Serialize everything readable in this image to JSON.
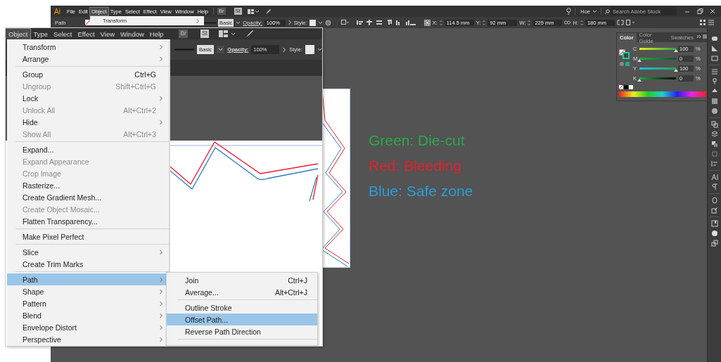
{
  "app": {
    "logo": "Ai",
    "menu": [
      {
        "label": "File",
        "selected": false
      },
      {
        "label": "Edit",
        "selected": false
      },
      {
        "label": "Object",
        "selected": true
      },
      {
        "label": "Type",
        "selected": false
      },
      {
        "label": "Select",
        "selected": false
      },
      {
        "label": "Effect",
        "selected": false
      },
      {
        "label": "View",
        "selected": false
      },
      {
        "label": "Window",
        "selected": false
      },
      {
        "label": "Help",
        "selected": false
      }
    ],
    "bridge_badge": "Br",
    "stock_badge": "St",
    "workspace": "Hoe",
    "search": {
      "placeholder": "Search Adobe Stock"
    },
    "open_menu_items": [
      "Transform"
    ]
  },
  "control_bar": {
    "selection": "Path",
    "stroke_profile": "Basic",
    "opacity_label": "Opacity:",
    "opacity": "100%",
    "style_label": "Style:",
    "x_label": "X:",
    "x": "114.5 mm",
    "y_label": "Y:",
    "y": "92 mm",
    "w_label": "W:",
    "w": "225 mm",
    "h_label": "H:",
    "h": "180 mm"
  },
  "annotations": [
    {
      "text": "Green: Die-cut",
      "color": "#2ea84a"
    },
    {
      "text": "Red: Bleeding",
      "color": "#e5202b"
    },
    {
      "text": "Blue: Safe zone",
      "color": "#2a9fd8"
    }
  ],
  "color_panel": {
    "tabs": [
      {
        "label": "Color",
        "selected": true
      },
      {
        "label": "Color Guide",
        "selected": false
      },
      {
        "label": "Swatches",
        "selected": false
      }
    ],
    "sliders": [
      {
        "channel": "C",
        "level": 1,
        "value": "100",
        "unit": "%"
      },
      {
        "channel": "M",
        "level": 0,
        "value": "0",
        "unit": "%"
      },
      {
        "channel": "Y",
        "level": 1,
        "value": "100",
        "unit": "%"
      },
      {
        "channel": "K",
        "level": 0,
        "value": "0",
        "unit": "%"
      }
    ]
  },
  "zoomed_view": {
    "menu_bar": [
      {
        "label": "Object",
        "selected": true
      },
      {
        "label": "Type",
        "selected": false
      },
      {
        "label": "Select",
        "selected": false
      },
      {
        "label": "Effect",
        "selected": false
      },
      {
        "label": "View",
        "selected": false
      },
      {
        "label": "Window",
        "selected": false
      },
      {
        "label": "Help",
        "selected": false
      }
    ],
    "bridge_badge": "Br",
    "stock_badge": "St",
    "stroke_profile": "Basic",
    "opacity_label": "Opacity:",
    "opacity": "100%",
    "style_label": "Style:",
    "object_menu": [
      [
        {
          "label": "Transform",
          "submenu": true,
          "disabled": false,
          "selected": false
        },
        {
          "label": "Arrange",
          "submenu": true,
          "disabled": false,
          "selected": false
        }
      ],
      [
        {
          "label": "Group",
          "shortcut": "Ctrl+G",
          "submenu": false,
          "disabled": false,
          "selected": false
        },
        {
          "label": "Ungroup",
          "shortcut": "Shift+Ctrl+G",
          "submenu": false,
          "disabled": true,
          "selected": false
        },
        {
          "label": "Lock",
          "submenu": true,
          "disabled": false,
          "selected": false
        },
        {
          "label": "Unlock All",
          "shortcut": "Alt+Ctrl+2",
          "submenu": false,
          "disabled": true,
          "selected": false
        },
        {
          "label": "Hide",
          "submenu": true,
          "disabled": false,
          "selected": false
        },
        {
          "label": "Show All",
          "shortcut": "Alt+Ctrl+3",
          "submenu": false,
          "disabled": true,
          "selected": false
        }
      ],
      [
        {
          "label": "Expand...",
          "submenu": false,
          "disabled": false,
          "selected": false
        },
        {
          "label": "Expand Appearance",
          "submenu": false,
          "disabled": true,
          "selected": false
        },
        {
          "label": "Crop Image",
          "submenu": false,
          "disabled": true,
          "selected": false
        },
        {
          "label": "Rasterize...",
          "submenu": false,
          "disabled": false,
          "selected": false
        },
        {
          "label": "Create Gradient Mesh...",
          "submenu": false,
          "disabled": false,
          "selected": false
        },
        {
          "label": "Create Object Mosaic...",
          "submenu": false,
          "disabled": true,
          "selected": false
        },
        {
          "label": "Flatten Transparency...",
          "submenu": false,
          "disabled": false,
          "selected": false
        }
      ],
      [
        {
          "label": "Make Pixel Perfect",
          "submenu": false,
          "disabled": false,
          "selected": false
        }
      ],
      [
        {
          "label": "Slice",
          "submenu": true,
          "disabled": false,
          "selected": false
        },
        {
          "label": "Create Trim Marks",
          "submenu": false,
          "disabled": false,
          "selected": false
        }
      ],
      [
        {
          "label": "Path",
          "submenu": true,
          "disabled": false,
          "selected": true
        },
        {
          "label": "Shape",
          "submenu": true,
          "disabled": false,
          "selected": false
        },
        {
          "label": "Pattern",
          "submenu": true,
          "disabled": false,
          "selected": false
        },
        {
          "label": "Blend",
          "submenu": true,
          "disabled": false,
          "selected": false
        },
        {
          "label": "Envelope Distort",
          "submenu": true,
          "disabled": false,
          "selected": false
        },
        {
          "label": "Perspective",
          "submenu": true,
          "disabled": false,
          "selected": false
        }
      ]
    ],
    "path_submenu": [
      [
        {
          "label": "Join",
          "shortcut": "Ctrl+J",
          "submenu": false,
          "disabled": false,
          "selected": false
        },
        {
          "label": "Average...",
          "shortcut": "Alt+Ctrl+J",
          "submenu": false,
          "disabled": false,
          "selected": false
        }
      ],
      [
        {
          "label": "Outline Stroke",
          "submenu": false,
          "disabled": false,
          "selected": false
        },
        {
          "label": "Offset Path...",
          "submenu": false,
          "disabled": false,
          "selected": true
        },
        {
          "label": "Reverse Path Direction",
          "submenu": false,
          "disabled": false,
          "selected": false
        }
      ]
    ]
  }
}
